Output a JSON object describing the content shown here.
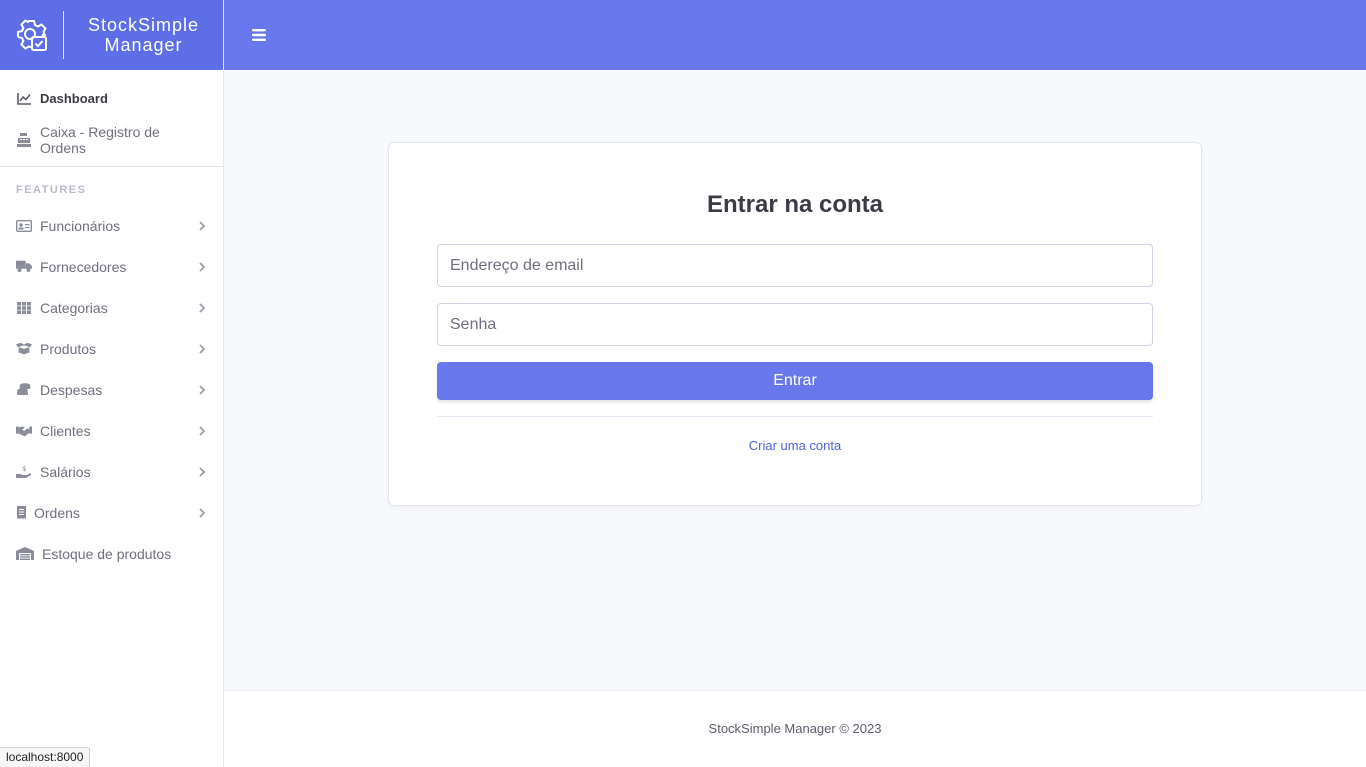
{
  "brand": {
    "name_line1": "StockSimple",
    "name_line2": "Manager",
    "icon": "gear-checklist-icon"
  },
  "sidebar": {
    "top_items": [
      {
        "label": "Dashboard",
        "icon": "chart-line-icon",
        "active": true
      },
      {
        "label": "Caixa - Registro de Ordens",
        "icon": "cash-register-icon"
      }
    ],
    "section_heading": "FEATURES",
    "feature_items": [
      {
        "label": "Funcionários",
        "icon": "id-card-icon",
        "has_submenu": true
      },
      {
        "label": "Fornecedores",
        "icon": "truck-icon",
        "has_submenu": true
      },
      {
        "label": "Categorias",
        "icon": "grid-icon",
        "has_submenu": true
      },
      {
        "label": "Produtos",
        "icon": "box-open-icon",
        "has_submenu": true
      },
      {
        "label": "Despesas",
        "icon": "coins-icon",
        "has_submenu": true
      },
      {
        "label": "Clientes",
        "icon": "handshake-icon",
        "has_submenu": true
      },
      {
        "label": "Salários",
        "icon": "hand-dollar-icon",
        "has_submenu": true
      },
      {
        "label": "Ordens",
        "icon": "receipt-icon",
        "has_submenu": true
      },
      {
        "label": "Estoque de produtos",
        "icon": "warehouse-icon",
        "has_submenu": false
      }
    ]
  },
  "topbar": {
    "toggle_icon": "hamburger-menu-icon"
  },
  "login": {
    "title": "Entrar na conta",
    "email_placeholder": "Endereço de email",
    "password_placeholder": "Senha",
    "submit_label": "Entrar",
    "create_account_label": "Criar uma conta"
  },
  "footer": {
    "text": "StockSimple Manager © 2023"
  },
  "status_bar": {
    "url": "localhost:8000"
  },
  "colors": {
    "accent": "#6877ec",
    "brand_bg": "#5d6ee6",
    "link": "#4e62d8"
  }
}
